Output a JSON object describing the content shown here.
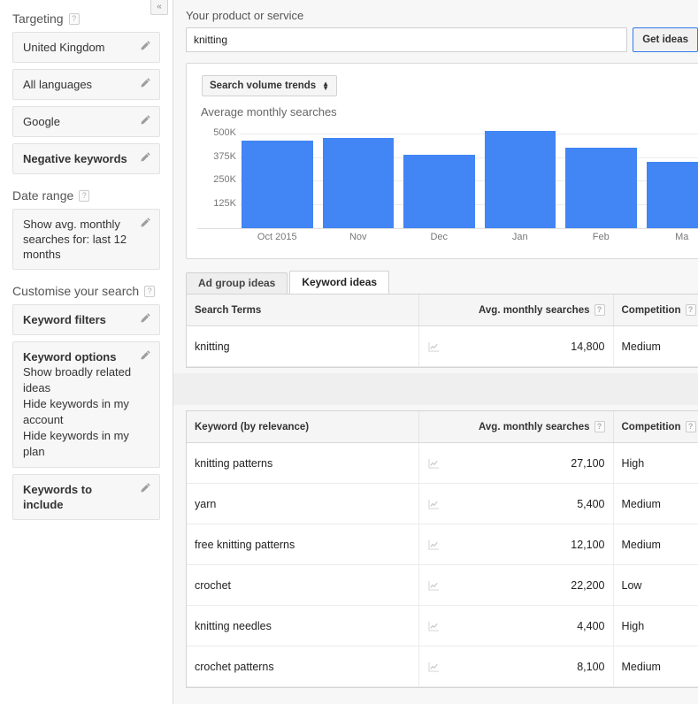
{
  "sidebar": {
    "collapse_label": "«",
    "sections": [
      {
        "title": "Targeting",
        "items": [
          {
            "label": "United Kingdom",
            "bold": false
          },
          {
            "label": "All languages",
            "bold": false
          },
          {
            "label": "Google",
            "bold": false
          },
          {
            "label": "Negative keywords",
            "bold": true
          }
        ]
      },
      {
        "title": "Date range",
        "items": [
          {
            "label": "Show avg. monthly searches for: last 12 months",
            "bold": false
          }
        ]
      },
      {
        "title": "Customise your search",
        "items": [
          {
            "label": "Keyword filters",
            "bold": true
          },
          {
            "label": "Keyword options",
            "bold": true,
            "sub": [
              "Show broadly related ideas",
              "Hide keywords in my account",
              "Hide keywords in my plan"
            ]
          },
          {
            "label": "Keywords to include",
            "bold": true
          }
        ]
      }
    ]
  },
  "search": {
    "label": "Your product or service",
    "value": "knitting",
    "placeholder": "Your product or service",
    "button_label": "Get ideas"
  },
  "chart_panel": {
    "select_label": "Search volume trends",
    "heading": "Average monthly searches"
  },
  "chart_data": {
    "type": "bar",
    "title": "Average monthly searches",
    "xlabel": "",
    "ylabel": "Average monthly searches",
    "categories": [
      "Oct 2015",
      "Nov",
      "Dec",
      "Jan",
      "Feb",
      "Ma"
    ],
    "values": [
      460000,
      475000,
      385000,
      515000,
      425000,
      348000
    ],
    "ytick_labels": [
      "125K",
      "250K",
      "375K",
      "500K"
    ],
    "ytick_values": [
      125000,
      250000,
      375000,
      500000
    ],
    "ylim": [
      0,
      550000
    ],
    "grid": true,
    "legend": "none",
    "bar_color": "#4285f4"
  },
  "tabs": [
    {
      "label": "Ad group ideas",
      "active": false
    },
    {
      "label": "Keyword ideas",
      "active": true
    }
  ],
  "search_terms_table": {
    "columns": [
      "Search Terms",
      "Avg. monthly searches",
      "Competition"
    ],
    "rows": [
      {
        "keyword": "knitting",
        "searches": "14,800",
        "competition": "Medium"
      }
    ]
  },
  "keyword_ideas_table": {
    "columns": [
      "Keyword (by relevance)",
      "Avg. monthly searches",
      "Competition"
    ],
    "rows": [
      {
        "keyword": "knitting patterns",
        "searches": "27,100",
        "competition": "High"
      },
      {
        "keyword": "yarn",
        "searches": "5,400",
        "competition": "Medium"
      },
      {
        "keyword": "free knitting patterns",
        "searches": "12,100",
        "competition": "Medium"
      },
      {
        "keyword": "crochet",
        "searches": "22,200",
        "competition": "Low"
      },
      {
        "keyword": "knitting needles",
        "searches": "4,400",
        "competition": "High"
      },
      {
        "keyword": "crochet patterns",
        "searches": "8,100",
        "competition": "Medium"
      }
    ]
  },
  "icons": {
    "help": "?",
    "pencil": "pencil-icon",
    "sparkline": "sparkline-icon"
  }
}
